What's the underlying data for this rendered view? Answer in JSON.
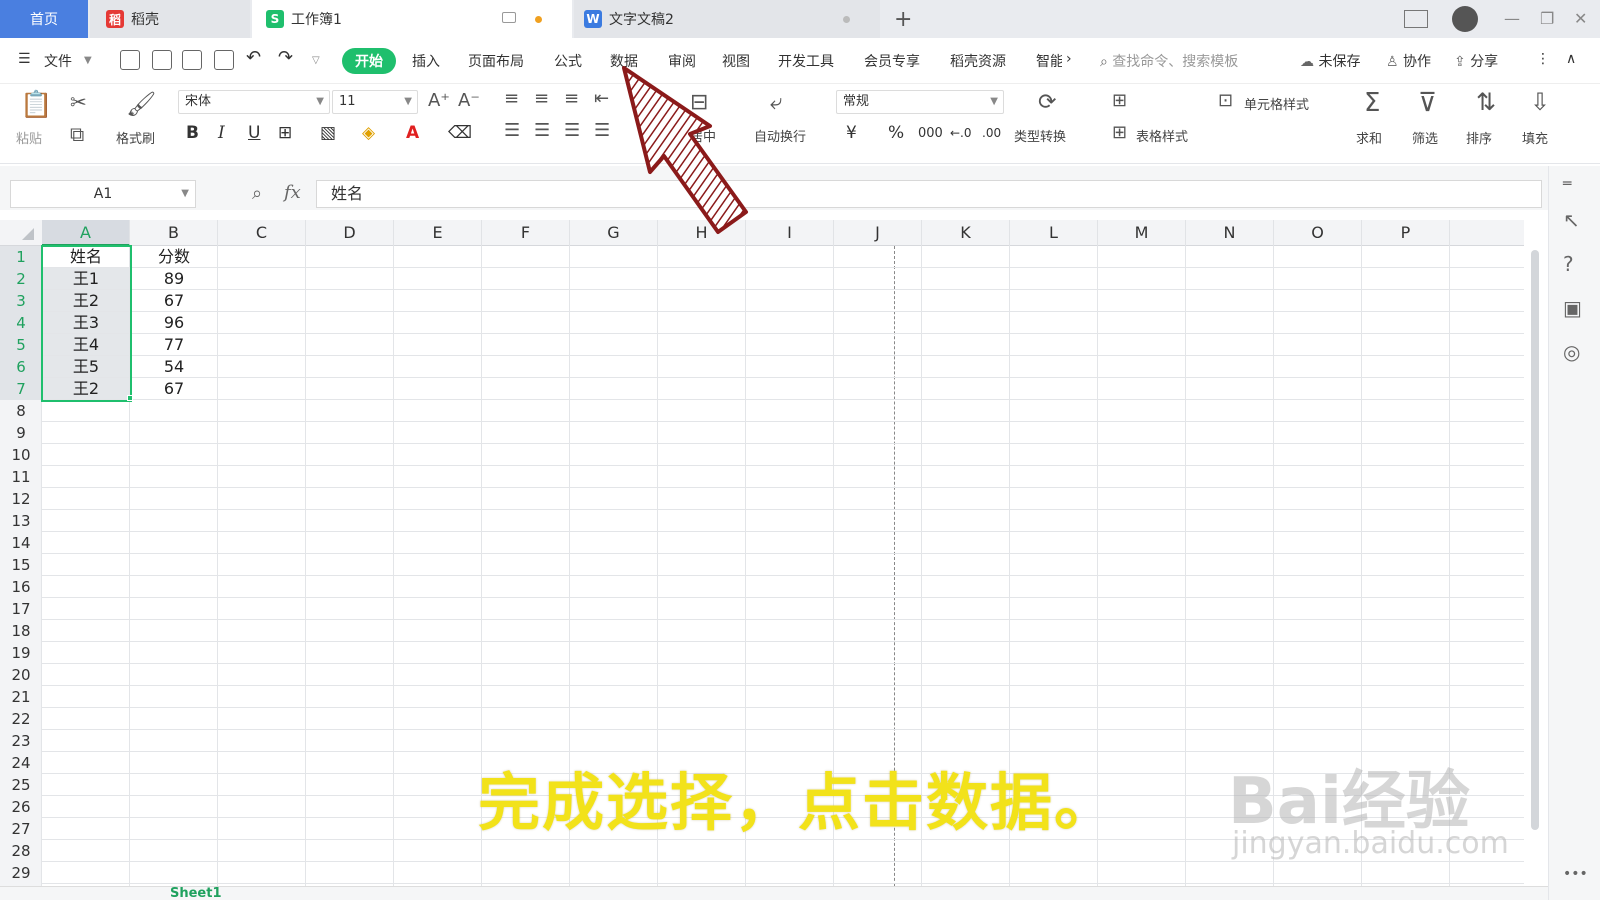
{
  "tabs": {
    "home": "首页",
    "daoke": "稻壳",
    "workbook": "工作簿1",
    "document": "文字文稿2",
    "add": "+"
  },
  "menu": {
    "file": "文件",
    "start": "开始",
    "items": [
      "插入",
      "页面布局",
      "公式",
      "数据",
      "审阅",
      "视图",
      "开发工具",
      "会员专享",
      "稻壳资源",
      "智能"
    ],
    "search_placeholder": "查找命令、搜索模板",
    "unsaved": "未保存",
    "collab": "协作",
    "share": "分享"
  },
  "ribbon": {
    "paste": "粘贴",
    "format_painter": "格式刷",
    "font_name": "宋体",
    "font_size": "11",
    "merge_center": "合并居中",
    "wrap": "自动换行",
    "number_format": "常规",
    "currency": "¥",
    "percent": "%",
    "thousands": "000",
    "type_convert": "类型转换",
    "cell_style": "单元格样式",
    "table_style": "表格样式",
    "sum": "求和",
    "filter": "筛选",
    "sort": "排序",
    "fill": "填充"
  },
  "formula_bar": {
    "name_box": "A1",
    "fx": "fx",
    "content": "姓名"
  },
  "sheet": {
    "columns": [
      "A",
      "B",
      "C",
      "D",
      "E",
      "F",
      "G",
      "H",
      "I",
      "J",
      "K",
      "L",
      "M",
      "N",
      "O",
      "P"
    ],
    "selected_column": "A",
    "rows": [
      "1",
      "2",
      "3",
      "4",
      "5",
      "6",
      "7",
      "8",
      "9",
      "10",
      "11",
      "12",
      "13",
      "14",
      "15",
      "16",
      "17",
      "18",
      "19",
      "20",
      "21",
      "22",
      "23",
      "24",
      "25",
      "26",
      "27",
      "28",
      "29"
    ],
    "data": [
      [
        "姓名",
        "分数"
      ],
      [
        "王1",
        "89"
      ],
      [
        "王2",
        "67"
      ],
      [
        "王3",
        "96"
      ],
      [
        "王4",
        "77"
      ],
      [
        "王5",
        "54"
      ],
      [
        "王2",
        "67"
      ]
    ],
    "tab_name": "Sheet1"
  },
  "caption": "完成选择，点击数据。",
  "watermark": {
    "brand": "Bai经验",
    "url": "jingyan.baidu.com"
  },
  "colors": {
    "accent_green": "#1fbf6d",
    "caption_yellow": "#f2e21a",
    "arrow_red": "#8b1a1a"
  }
}
